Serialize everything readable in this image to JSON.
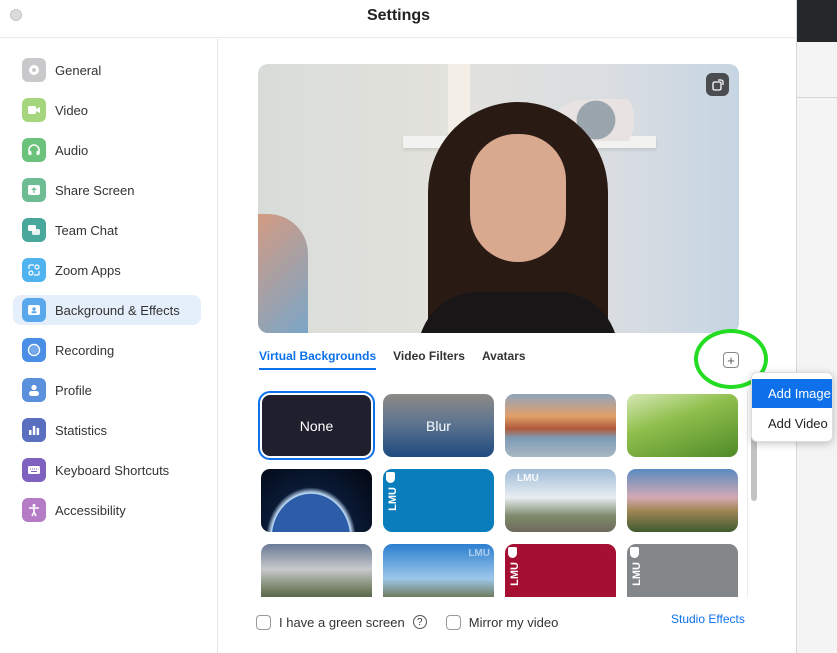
{
  "window": {
    "title": "Settings"
  },
  "sidebar": {
    "items": [
      {
        "label": "General",
        "icon": "gear-icon",
        "color": "#c9c9cb"
      },
      {
        "label": "Video",
        "icon": "video-camera-icon",
        "color": "#a5d67d"
      },
      {
        "label": "Audio",
        "icon": "headphones-icon",
        "color": "#6bc27a"
      },
      {
        "label": "Share Screen",
        "icon": "share-screen-icon",
        "color": "#6ebc94"
      },
      {
        "label": "Team Chat",
        "icon": "chat-bubbles-icon",
        "color": "#48a89c"
      },
      {
        "label": "Zoom Apps",
        "icon": "zoom-apps-icon",
        "color": "#4fb3ef"
      },
      {
        "label": "Background & Effects",
        "icon": "person-background-icon",
        "color": "#5aa8ec",
        "active": true
      },
      {
        "label": "Recording",
        "icon": "record-icon",
        "color": "#4a8ee6"
      },
      {
        "label": "Profile",
        "icon": "profile-icon",
        "color": "#5b90dd"
      },
      {
        "label": "Statistics",
        "icon": "bar-chart-icon",
        "color": "#5a6fc0"
      },
      {
        "label": "Keyboard Shortcuts",
        "icon": "keyboard-icon",
        "color": "#7f62bf"
      },
      {
        "label": "Accessibility",
        "icon": "accessibility-icon",
        "color": "#b57bc7"
      }
    ]
  },
  "main": {
    "tabs": [
      {
        "label": "Virtual Backgrounds",
        "active": true
      },
      {
        "label": "Video Filters"
      },
      {
        "label": "Avatars"
      }
    ],
    "add_button_label": "+",
    "add_menu": [
      {
        "label": "Add Image",
        "active": true
      },
      {
        "label": "Add Video"
      }
    ],
    "backgrounds": [
      {
        "label": "None",
        "kind": "none",
        "selected": true
      },
      {
        "label": "Blur",
        "kind": "blur"
      },
      {
        "label": "",
        "kind": "golden-gate"
      },
      {
        "label": "",
        "kind": "grass"
      },
      {
        "label": "",
        "kind": "earth"
      },
      {
        "label": "LMU",
        "kind": "lmu-blue"
      },
      {
        "label": "LMU",
        "kind": "lmu-campus"
      },
      {
        "label": "",
        "kind": "palm-campus"
      },
      {
        "label": "",
        "kind": "building"
      },
      {
        "label": "LMU",
        "kind": "sky-campus"
      },
      {
        "label": "LMU",
        "kind": "lmu-red"
      },
      {
        "label": "LMU",
        "kind": "lmu-gray"
      }
    ],
    "footer": {
      "green_screen_label": "I have a green screen",
      "help_label": "?",
      "mirror_label": "Mirror my video",
      "studio_effects_label": "Studio Effects"
    }
  },
  "colors": {
    "accent": "#0e71eb",
    "highlight_ring": "#22dd22"
  }
}
